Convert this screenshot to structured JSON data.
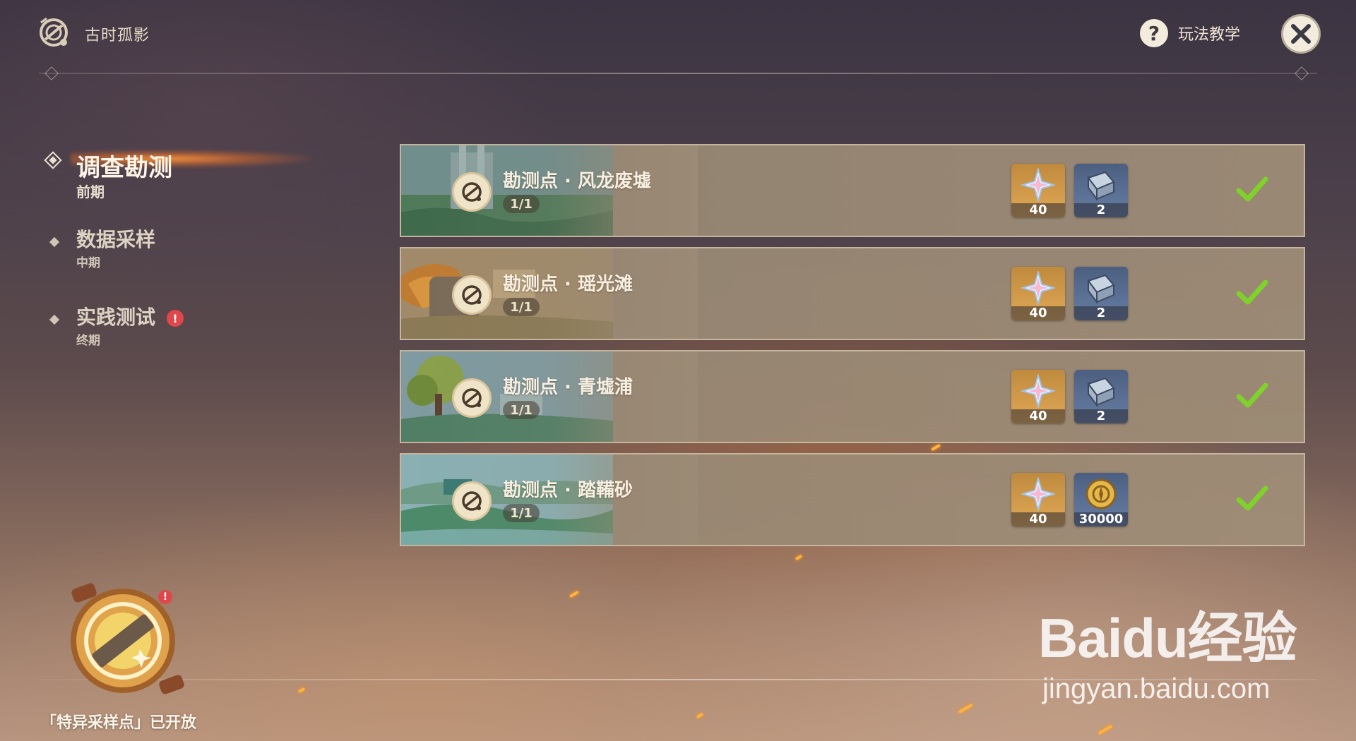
{
  "header": {
    "title": "古时孤影",
    "help_label": "玩法教学",
    "logo_icon": "compass-gear-icon",
    "help_icon": "question-mark-icon",
    "close_icon": "close-icon"
  },
  "nav": {
    "items": [
      {
        "label": "调查勘测",
        "sub": "前期",
        "active": true
      },
      {
        "label": "数据采样",
        "sub": "中期",
        "active": false
      },
      {
        "label": "实践测试",
        "sub": "终期",
        "active": false,
        "alert": "!"
      }
    ]
  },
  "surveys": [
    {
      "title": "勘测点 · 风龙废墟",
      "progress": "1/1",
      "rewards": [
        {
          "icon": "primogem-icon",
          "count": "40"
        },
        {
          "icon": "hero-wit-book-icon",
          "count": "2"
        }
      ],
      "completed": true
    },
    {
      "title": "勘测点 · 瑶光滩",
      "progress": "1/1",
      "rewards": [
        {
          "icon": "primogem-icon",
          "count": "40"
        },
        {
          "icon": "hero-wit-book-icon",
          "count": "2"
        }
      ],
      "completed": true
    },
    {
      "title": "勘测点 · 青墟浦",
      "progress": "1/1",
      "rewards": [
        {
          "icon": "primogem-icon",
          "count": "40"
        },
        {
          "icon": "hero-wit-book-icon",
          "count": "2"
        }
      ],
      "completed": true
    },
    {
      "title": "勘测点 · 踏鞴砂",
      "progress": "1/1",
      "rewards": [
        {
          "icon": "primogem-icon",
          "count": "40"
        },
        {
          "icon": "mora-coin-icon",
          "count": "30000"
        }
      ],
      "completed": true
    }
  ],
  "widget": {
    "label": "「特异采样点」已开放",
    "badge": "!",
    "icon": "sampling-device-icon"
  },
  "watermark": {
    "brand": "Baidu经验",
    "url": "jingyan.baidu.com"
  },
  "colors": {
    "accent_orange": "#ff9a3c",
    "check_green": "#7fd22a",
    "alert_red": "#e0474c",
    "card_bg": "#9a8a74"
  }
}
